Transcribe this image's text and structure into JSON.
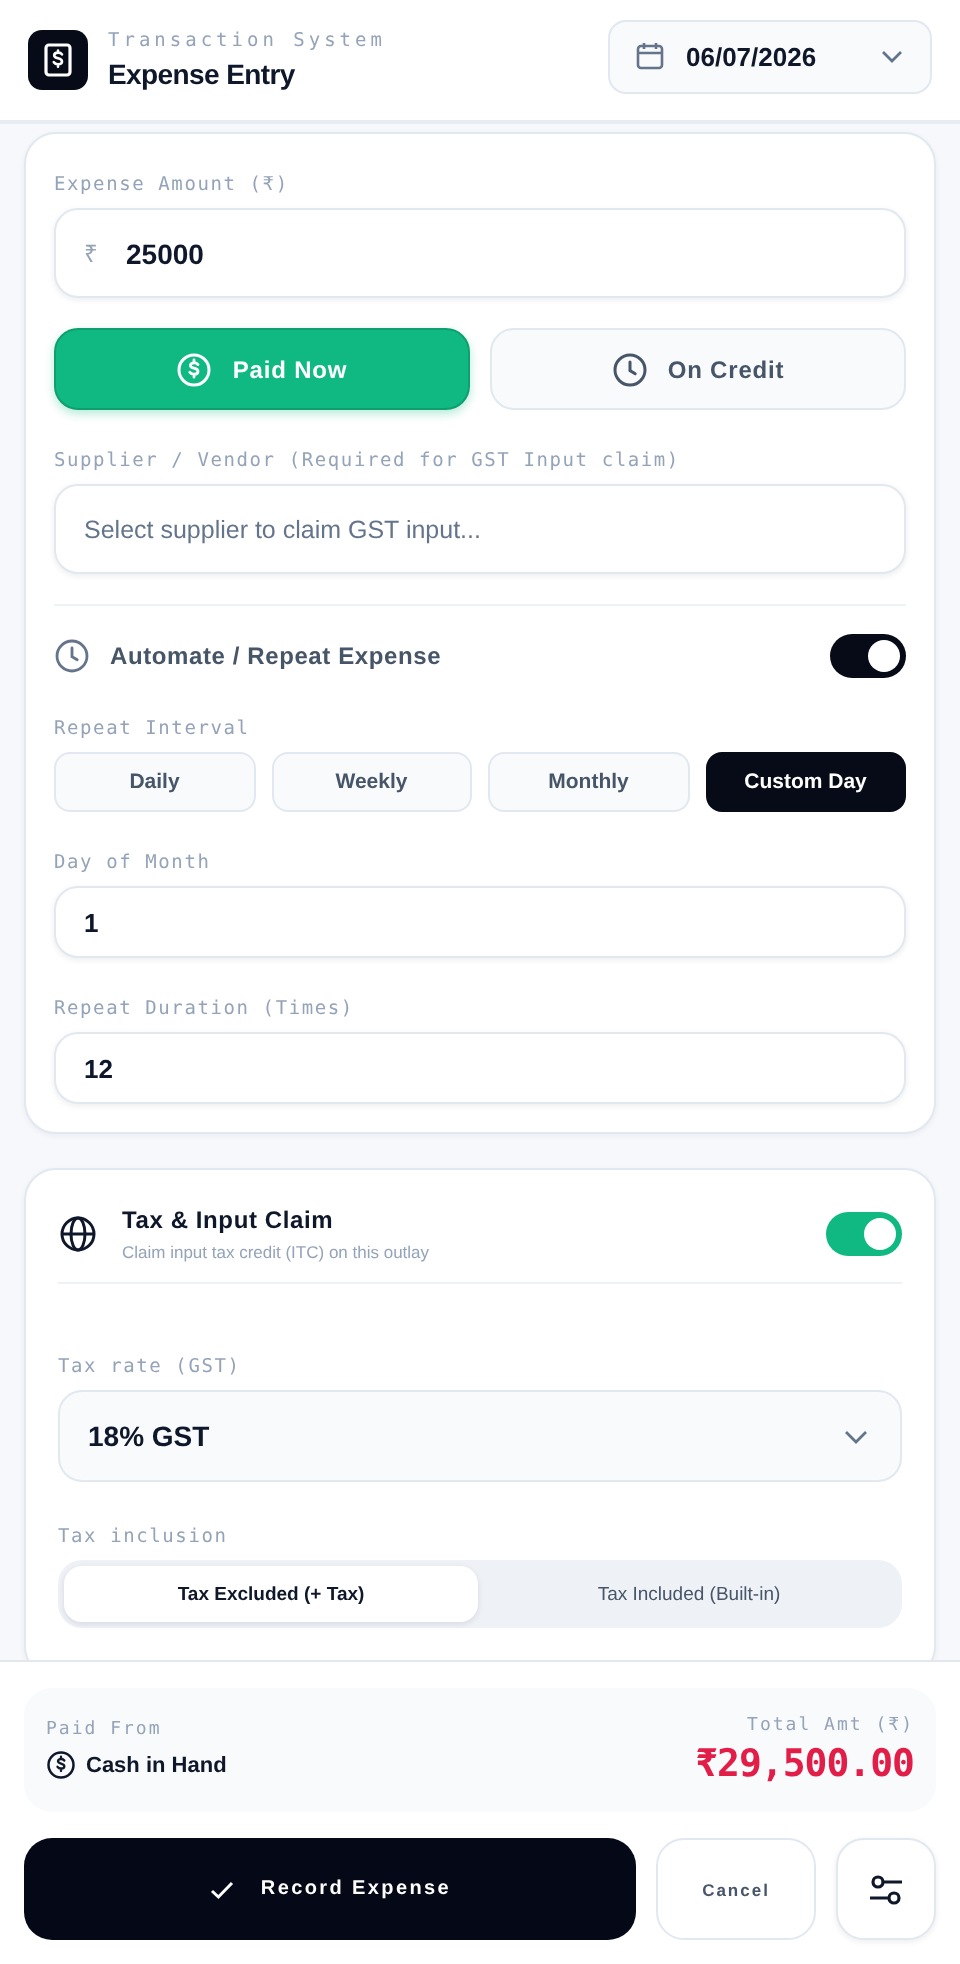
{
  "header": {
    "subtitle": "Transaction System",
    "title": "Expense Entry",
    "date": "06/07/2026"
  },
  "amount": {
    "label": "Expense Amount (₹)",
    "currency": "₹",
    "value": "25000"
  },
  "payment_modes": [
    {
      "label": "Paid Now",
      "kind": "cash",
      "selected": true
    },
    {
      "label": "On Credit",
      "kind": "clock",
      "selected": false
    }
  ],
  "supplier": {
    "label": "Supplier / Vendor (Required for GST Input claim)",
    "placeholder": "Select supplier to claim GST input..."
  },
  "repeat": {
    "label": "Automate / Repeat Expense",
    "on": true,
    "interval_label": "Repeat Interval",
    "intervals": [
      {
        "label": "Daily",
        "selected": false
      },
      {
        "label": "Weekly",
        "selected": false
      },
      {
        "label": "Monthly",
        "selected": false
      },
      {
        "label": "Custom Day",
        "selected": true
      }
    ],
    "day_label": "Day of Month",
    "day_value": "1",
    "duration_label": "Repeat Duration (Times)",
    "duration_value": "12"
  },
  "tax": {
    "title": "Tax & Input Claim",
    "subtitle": "Claim input tax credit (ITC) on this outlay",
    "on": true,
    "rate_label": "Tax rate (GST)",
    "rate_value": "18% GST",
    "inclusion_label": "Tax inclusion",
    "inclusion_options": [
      {
        "label": "Tax Excluded (+ Tax)",
        "selected": true
      },
      {
        "label": "Tax Included (Built-in)",
        "selected": false
      }
    ]
  },
  "summary": {
    "paid_from_label": "Paid From",
    "paid_from": "Cash in Hand",
    "total_label": "Total Amt (₹)",
    "total": "₹29,500.00"
  },
  "actions": {
    "record": "Record Expense",
    "cancel": "Cancel"
  }
}
